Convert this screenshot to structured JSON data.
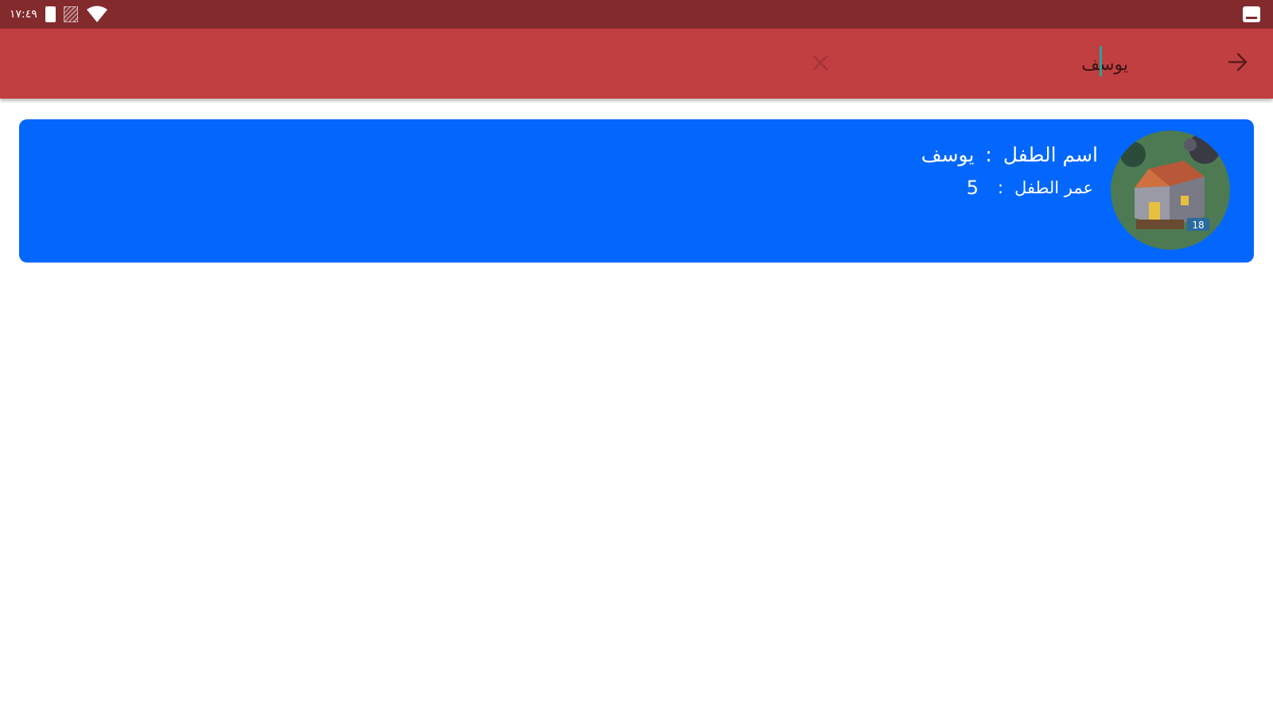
{
  "status_bar": {
    "time": "١٧:٤٩",
    "icons": [
      "battery-icon",
      "sim-icon",
      "wifi-icon",
      "image-notification-icon"
    ]
  },
  "app_bar": {
    "search_value": "يوسف",
    "back_icon": "arrow-right-icon",
    "clear_icon": "close-icon",
    "colors": {
      "background": "#c13f41",
      "status_bar": "#832a2d",
      "caret": "#26a69a"
    }
  },
  "results": [
    {
      "name_label": "اسم الطفل",
      "separator": ":",
      "name_value": "يوسف",
      "age_label": "عمر الطفل",
      "age_value": "5",
      "avatar_icon": "house-avatar-icon",
      "avatar_badge": "18",
      "card_color": "#0367fd"
    }
  ]
}
